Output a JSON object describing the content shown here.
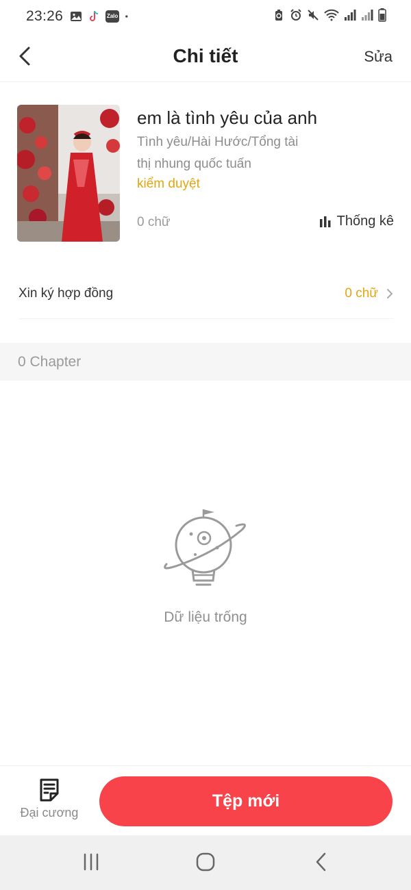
{
  "status_bar": {
    "time": "23:26",
    "left_icons": [
      "gallery-icon",
      "tiktok-icon",
      "zalo-icon",
      "dot-icon"
    ],
    "zalo_text": "Zalo",
    "right_icons": [
      "battery-saver-icon",
      "alarm-icon",
      "mute-icon",
      "wifi-icon",
      "signal-icon",
      "signal-icon",
      "battery-icon"
    ]
  },
  "header": {
    "back_icon": "chevron-left-icon",
    "title": "Chi tiết",
    "edit_label": "Sửa"
  },
  "book": {
    "title": "em là tình yêu của anh",
    "genres": "Tình yêu/Hài Hước/Tổng tài",
    "author": "thị nhung quốc tuấn",
    "status": "kiểm duyệt",
    "word_count": "0 chữ",
    "stats_icon": "bar-chart-icon",
    "stats_label": "Thống kê"
  },
  "contract": {
    "label": "Xin ký hợp đồng",
    "value": "0 chữ",
    "arrow_icon": "chevron-right-icon"
  },
  "chapters": {
    "count_label": "0 Chapter",
    "empty_icon": "lightbulb-planet-icon",
    "empty_text": "Dữ liệu trống"
  },
  "bottom_bar": {
    "outline_icon": "outline-document-icon",
    "outline_label": "Đại cương",
    "new_file_label": "Tệp mới"
  },
  "system_nav": {
    "recents_icon": "recents-icon",
    "home_icon": "home-icon",
    "back_icon": "back-icon"
  },
  "colors": {
    "accent_red": "#f74349",
    "status_gold": "#e3a511",
    "muted_text": "#8c8c8c"
  }
}
